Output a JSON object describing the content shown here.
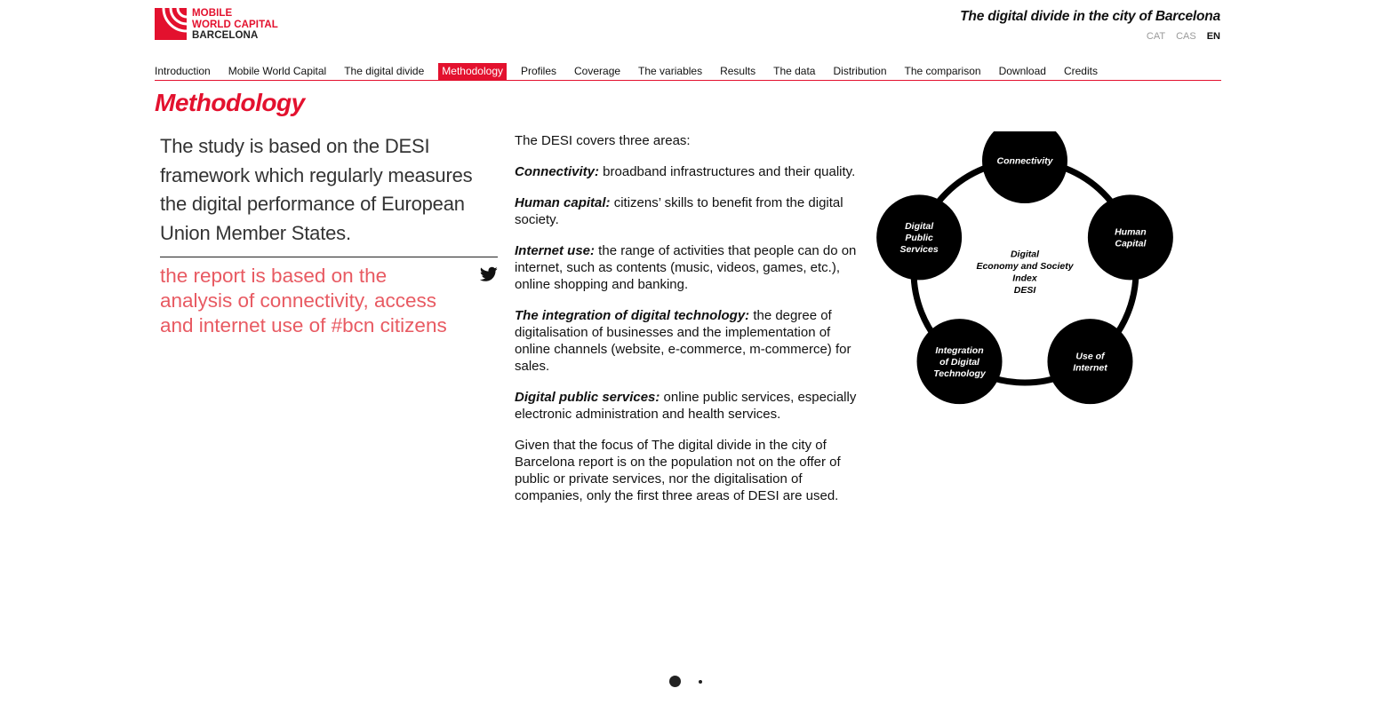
{
  "brand": {
    "line1": "MOBILE",
    "line2": "WORLD CAPITAL",
    "line3": "BARCELONA",
    "accent_color": "#e3112e"
  },
  "header": {
    "site_title": "The digital divide in the city of Barcelona",
    "languages": [
      "CAT",
      "CAS",
      "EN"
    ],
    "active_language": "EN"
  },
  "nav": {
    "items": [
      "Introduction",
      "Mobile World Capital",
      "The digital divide",
      "Methodology",
      "Profiles",
      "Coverage",
      "The variables",
      "Results",
      "The data",
      "Distribution",
      "The comparison",
      "Download",
      "Credits"
    ],
    "active": "Methodology"
  },
  "page": {
    "title": "Methodology",
    "intro": "The study is based on the DESI framework which regularly measures the digital performance of European Union Member States.",
    "quote": "the report is based on the analysis of connectivity, access and internet use of #bcn citizens",
    "share_icon": "twitter-icon",
    "quote_color": "#e85a62"
  },
  "desi": {
    "lead": "The DESI covers three areas:",
    "areas": [
      {
        "term": "Connectivity:",
        "text": " broadband infrastructures and their quality."
      },
      {
        "term": "Human capital:",
        "text": " citizens’ skills to benefit from the digital society."
      },
      {
        "term": "Internet use:",
        "text": " the range of activities that people can do on internet, such as contents (music, videos, games, etc.), online shopping and banking."
      },
      {
        "term": "The integration of digital technology:",
        "text": " the degree of digitalisation of businesses and the implementation of online channels (website, e-commerce, m-commerce) for sales."
      },
      {
        "term": "Digital public services:",
        "text": " online public services, especially electronic administration and health services."
      }
    ],
    "closing": "Given that the focus of The digital divide in the city of Barcelona report is on the population not on the offer of public or private services, nor the digitalisation of companies, only the first three areas of DESI are used."
  },
  "diagram": {
    "center": [
      "Digital",
      "Economy and Society",
      "Index",
      "DESI"
    ],
    "nodes": [
      {
        "label": [
          "Connectivity"
        ]
      },
      {
        "label": [
          "Human",
          "Capital"
        ]
      },
      {
        "label": [
          "Use of",
          "Internet"
        ]
      },
      {
        "label": [
          "Integration",
          "of Digital",
          "Technology"
        ]
      },
      {
        "label": [
          "Digital",
          "Public",
          "Services"
        ]
      }
    ]
  },
  "pager": {
    "pages": 2,
    "current": 1
  }
}
